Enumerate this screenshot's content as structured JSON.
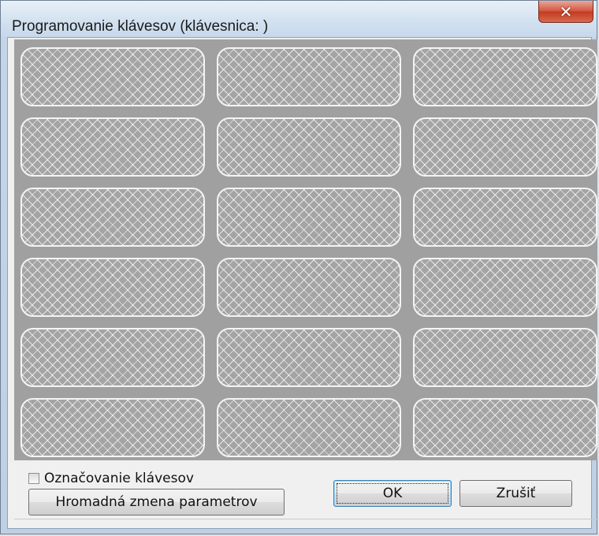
{
  "window": {
    "title": "Programovanie klávesov (klávesnica:  )"
  },
  "controls": {
    "mark_keys_label": "Označovanie klávesov",
    "mark_keys_checked": false,
    "bulk_change_label": "Hromadná zmena parametrov",
    "ok_label": "OK",
    "cancel_label": "Zrušiť"
  },
  "keys": {
    "rows": 6,
    "columns": 3,
    "labels": [
      "",
      "",
      "",
      "",
      "",
      "",
      "",
      "",
      "",
      "",
      "",
      "",
      "",
      "",
      "",
      "",
      "",
      ""
    ]
  },
  "colors": {
    "grid_background": "#a0a0a0",
    "key_border": "#f4f4f4",
    "close_button": "#c23a22"
  }
}
